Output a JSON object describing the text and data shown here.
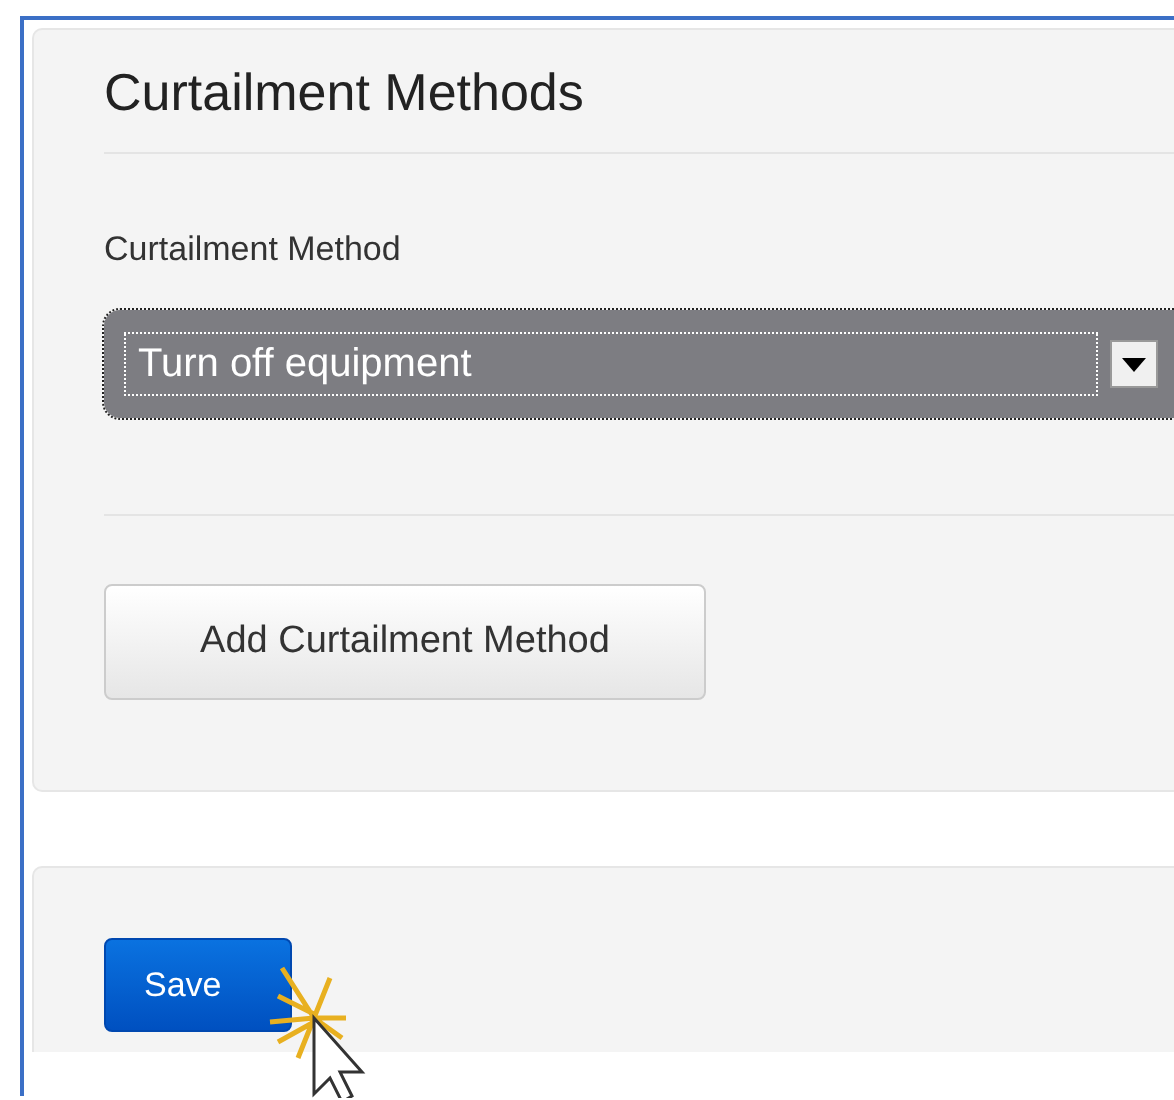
{
  "section": {
    "title": "Curtailment Methods",
    "field_label": "Curtailment Method",
    "select": {
      "value": "Turn off equipment",
      "focused": true
    },
    "add_button": "Add Curtailment Method"
  },
  "footer": {
    "save_button": "Save"
  }
}
